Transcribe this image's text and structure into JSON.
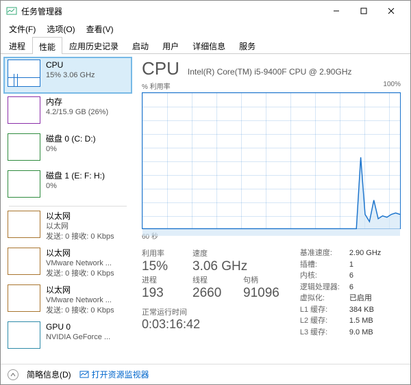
{
  "window": {
    "title": "任务管理器"
  },
  "menu": {
    "file": "文件(F)",
    "options": "选项(O)",
    "view": "查看(V)"
  },
  "tabs": [
    "进程",
    "性能",
    "应用历史记录",
    "启动",
    "用户",
    "详细信息",
    "服务"
  ],
  "active_tab": 1,
  "sidebar": [
    {
      "name": "CPU",
      "sub": "15% 3.06 GHz",
      "thumb": "cpu",
      "selected": true
    },
    {
      "name": "内存",
      "sub": "4.2/15.9 GB (26%)",
      "thumb": "mem"
    },
    {
      "name": "磁盘 0 (C: D:)",
      "sub": "0%",
      "thumb": "disk"
    },
    {
      "name": "磁盘 1 (E: F: H:)",
      "sub": "0%",
      "thumb": "disk"
    },
    {
      "name": "以太网",
      "sub": "以太网",
      "sub2": "发送: 0 接收: 0 Kbps",
      "thumb": "net"
    },
    {
      "name": "以太网",
      "sub": "VMware Network ...",
      "sub2": "发送: 0 接收: 0 Kbps",
      "thumb": "net"
    },
    {
      "name": "以太网",
      "sub": "VMware Network ...",
      "sub2": "发送: 0 接收: 0 Kbps",
      "thumb": "net"
    },
    {
      "name": "GPU 0",
      "sub": "NVIDIA GeForce ...",
      "thumb": "gpu"
    }
  ],
  "main": {
    "title": "CPU",
    "model": "Intel(R) Core(TM) i5-9400F CPU @ 2.90GHz",
    "chart_top_left": "% 利用率",
    "chart_top_right": "100%",
    "chart_bottom_left": "60 秒",
    "stats_left": [
      [
        {
          "lab": "利用率",
          "val": "15%"
        },
        {
          "lab": "速度",
          "val": "3.06 GHz"
        }
      ],
      [
        {
          "lab": "进程",
          "val": "193"
        },
        {
          "lab": "线程",
          "val": "2660"
        },
        {
          "lab": "句柄",
          "val": "91096"
        }
      ]
    ],
    "uptime_lab": "正常运行时间",
    "uptime": "0:03:16:42",
    "stats_right": [
      {
        "k": "基准速度:",
        "v": "2.90 GHz"
      },
      {
        "k": "插槽:",
        "v": "1"
      },
      {
        "k": "内核:",
        "v": "6"
      },
      {
        "k": "逻辑处理器:",
        "v": "6"
      },
      {
        "k": "虚拟化:",
        "v": "已启用"
      },
      {
        "k": "L1 缓存:",
        "v": "384 KB"
      },
      {
        "k": "L2 缓存:",
        "v": "1.5 MB"
      },
      {
        "k": "L3 缓存:",
        "v": "9.0 MB"
      }
    ]
  },
  "footer": {
    "fewer": "简略信息(D)",
    "resmon": "打开资源监视器"
  },
  "chart_data": {
    "type": "line",
    "title": "% 利用率",
    "ylabel": "%",
    "ylim": [
      0,
      100
    ],
    "x_seconds": 60,
    "values": [
      5,
      5,
      5,
      5,
      5,
      5,
      5,
      5,
      5,
      5,
      5,
      5,
      5,
      5,
      5,
      5,
      5,
      5,
      5,
      5,
      5,
      5,
      5,
      5,
      5,
      5,
      5,
      5,
      5,
      5,
      5,
      5,
      5,
      5,
      5,
      5,
      5,
      5,
      5,
      5,
      5,
      5,
      5,
      5,
      5,
      5,
      5,
      5,
      5,
      5,
      55,
      15,
      10,
      25,
      12,
      14,
      13,
      15,
      16,
      15
    ]
  }
}
